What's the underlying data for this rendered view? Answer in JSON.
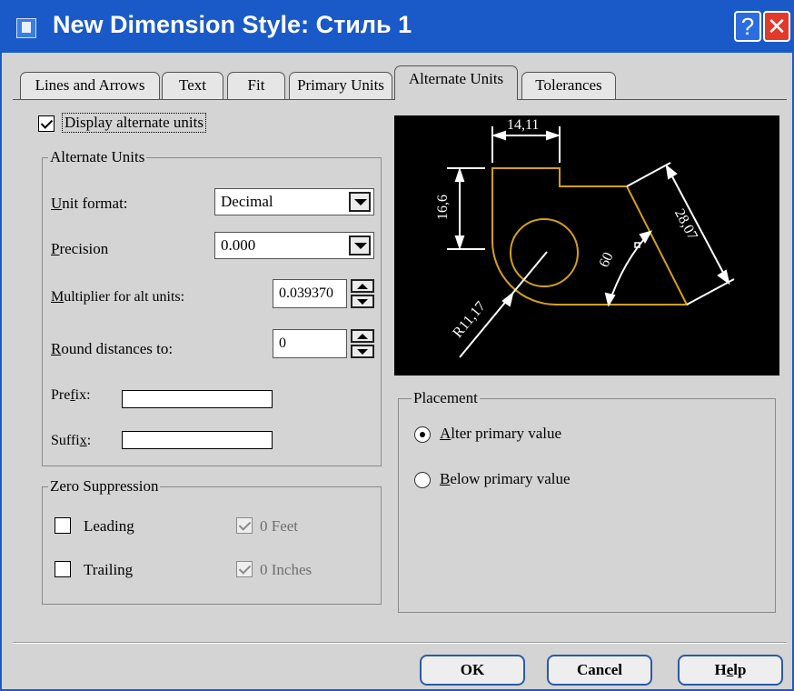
{
  "window": {
    "title": "New Dimension Style: Стиль 1",
    "help_glyph": "?",
    "close_glyph": "✕"
  },
  "tabs": [
    {
      "label": "Lines and Arrows"
    },
    {
      "label": "Text"
    },
    {
      "label": "Fit"
    },
    {
      "label": "Primary Units"
    },
    {
      "label": "Alternate Units",
      "active": true
    },
    {
      "label": "Tolerances"
    }
  ],
  "display_alternate_units": {
    "label": "Display alternate units",
    "checked": true
  },
  "alternate_units_group": {
    "title": "Alternate Units",
    "unit_format": {
      "label_pre": "",
      "mnemonic": "U",
      "label_post": "nit format:",
      "value": "Decimal"
    },
    "precision": {
      "label_pre": "",
      "mnemonic": "P",
      "label_post": "recision",
      "value": "0.000"
    },
    "multiplier": {
      "label_pre": "",
      "mnemonic": "M",
      "label_post": "ultiplier for alt units:",
      "value": "0.039370"
    },
    "round": {
      "label_pre": "",
      "mnemonic": "R",
      "label_post": "ound distances to:",
      "value": "0"
    },
    "prefix": {
      "label_pre": "Pre",
      "mnemonic": "f",
      "label_post": "ix:",
      "value": ""
    },
    "suffix": {
      "label_pre": "Suffi",
      "mnemonic": "x",
      "label_post": ":",
      "value": ""
    }
  },
  "zero_suppression": {
    "title": "Zero Suppression",
    "leading": {
      "label": "Leading",
      "checked": false
    },
    "trailing": {
      "label": "Trailing",
      "checked": false
    },
    "feet": {
      "label": "0 Feet",
      "checked": true,
      "disabled": true
    },
    "inches": {
      "label": "0 Inches",
      "checked": true,
      "disabled": true
    }
  },
  "preview": {
    "dims": {
      "top": "14,11",
      "left": "16,6",
      "diag": "28,07",
      "angle": "60",
      "radius": "R11,17"
    },
    "colors": {
      "background": "#000000",
      "outline": "#d4a017",
      "dimension": "#ffffff"
    }
  },
  "placement": {
    "title": "Placement",
    "options": [
      {
        "label_pre": "",
        "mnemonic": "A",
        "label_post": "lter primary value",
        "selected": true
      },
      {
        "label_pre": "",
        "mnemonic": "B",
        "label_post": "elow primary value",
        "selected": false
      }
    ]
  },
  "buttons": {
    "ok": "OK",
    "cancel": "Cancel",
    "help": {
      "label_pre": "H",
      "mnemonic": "e",
      "label_post": "lp"
    }
  },
  "colors": {
    "titlebar": "#1a5ac8",
    "close": "#e03a2a",
    "dialog_bg": "#d4d4d4"
  }
}
